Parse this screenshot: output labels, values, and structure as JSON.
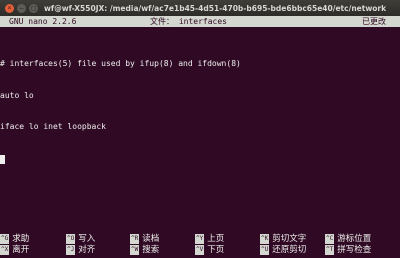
{
  "window": {
    "title": "wf@wf-X550JX: /media/wf/ac7e1b45-4d51-470b-b695-bde6bbc65e40/etc/network",
    "buttons": {
      "close": "×",
      "minimize": "–",
      "maximize": "□"
    }
  },
  "header": {
    "version": "GNU nano 2.2.6",
    "file": "文件： interfaces",
    "modified": "已更改"
  },
  "buffer": {
    "lines": [
      "# interfaces(5) file used by ifup(8) and ifdown(8)",
      "auto lo",
      "iface lo inet loopback"
    ]
  },
  "shortcuts": {
    "row1": [
      {
        "key": "^G",
        "label": "求助"
      },
      {
        "key": "^O",
        "label": "写入"
      },
      {
        "key": "^R",
        "label": "读档"
      },
      {
        "key": "^Y",
        "label": "上页"
      },
      {
        "key": "^K",
        "label": "剪切文字"
      },
      {
        "key": "^C",
        "label": "游标位置"
      }
    ],
    "row2": [
      {
        "key": "^X",
        "label": "离开"
      },
      {
        "key": "^J",
        "label": "对齐"
      },
      {
        "key": "^W",
        "label": "搜索"
      },
      {
        "key": "^V",
        "label": "下页"
      },
      {
        "key": "^U",
        "label": "还原剪切"
      },
      {
        "key": "^T",
        "label": "拼写检查"
      }
    ]
  },
  "colors": {
    "terminal_bg": "#300a24",
    "bar_bg": "#d3d7cf",
    "text": "#eeeeec",
    "close_button": "#e2613b"
  }
}
